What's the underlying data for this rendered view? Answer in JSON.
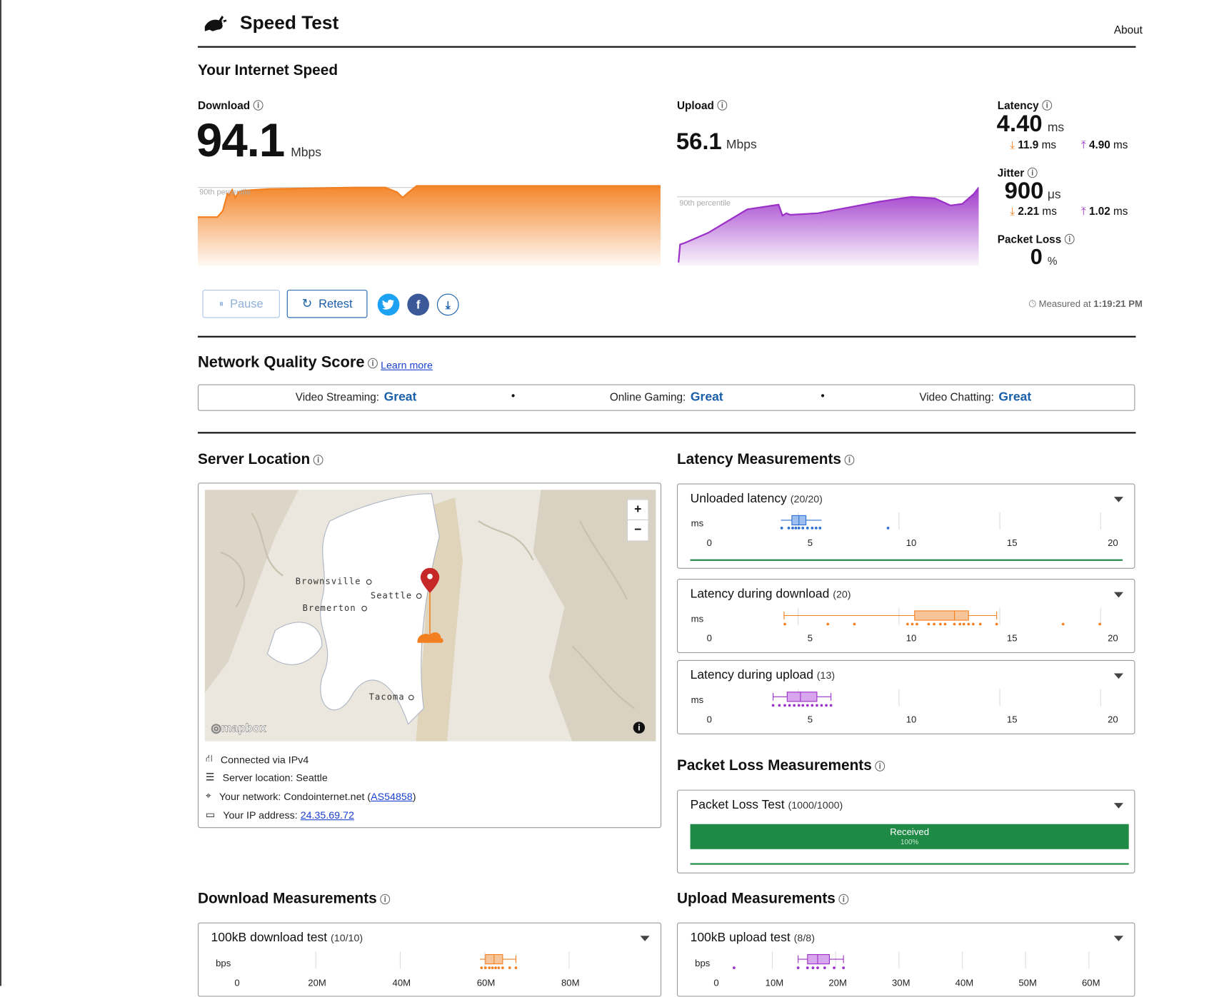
{
  "header": {
    "app_title": "Speed Test",
    "about_link": "About"
  },
  "speed": {
    "section_title": "Your Internet Speed",
    "download": {
      "label": "Download",
      "value": "94.1",
      "unit": "Mbps",
      "percentile_label": "90th percentile"
    },
    "upload": {
      "label": "Upload",
      "value": "56.1",
      "unit": "Mbps",
      "percentile_label": "90th percentile"
    },
    "latency": {
      "label": "Latency",
      "value": "4.40",
      "unit": "ms",
      "down_value": "11.9",
      "down_unit": "ms",
      "up_value": "4.90",
      "up_unit": "ms"
    },
    "jitter": {
      "label": "Jitter",
      "value": "900",
      "unit": "μs",
      "down_value": "2.21",
      "down_unit": "ms",
      "up_value": "1.02",
      "up_unit": "ms"
    },
    "packet_loss": {
      "label": "Packet Loss",
      "value": "0",
      "unit": "%"
    },
    "measured_prefix": "Measured at",
    "measured_time": "1:19:21 PM"
  },
  "actions": {
    "pause_label": "Pause",
    "retest_label": "Retest"
  },
  "nqs": {
    "title": "Network Quality Score",
    "learn_more": "Learn more",
    "items": [
      {
        "label": "Video Streaming:",
        "value": "Great"
      },
      {
        "label": "Online Gaming:",
        "value": "Great"
      },
      {
        "label": "Video Chatting:",
        "value": "Great"
      }
    ],
    "separator": "•"
  },
  "server": {
    "title": "Server Location",
    "map_labels": {
      "brownsville": "Brownsville",
      "seattle": "Seattle",
      "bremerton": "Bremerton",
      "tacoma": "Tacoma"
    },
    "map_brand": "mapbox",
    "zoom_in": "+",
    "zoom_out": "−",
    "connected": "Connected via IPv4",
    "server_location": "Server location: Seattle",
    "network_prefix": "Your network: Condointernet.net (",
    "network_as": "AS54858",
    "network_suffix": ")",
    "ip_prefix": "Your IP address:",
    "ip": "24.35.69.72"
  },
  "latency_measurements": {
    "title": "Latency Measurements",
    "unit": "ms",
    "ticks": [
      "0",
      "5",
      "10",
      "15",
      "20"
    ],
    "cards": [
      {
        "title": "Unloaded latency",
        "count": "(20/20)"
      },
      {
        "title": "Latency during download",
        "count": "(20)"
      },
      {
        "title": "Latency during upload",
        "count": "(13)"
      }
    ]
  },
  "packet_loss_measurements": {
    "title": "Packet Loss Measurements",
    "card_title": "Packet Loss Test",
    "count": "(1000/1000)",
    "bar_label": "Received",
    "bar_percent": "100%",
    "received_fraction": 1.0
  },
  "download_measurements": {
    "title": "Download Measurements",
    "card_title": "100kB download test",
    "count": "(10/10)",
    "unit": "bps",
    "ticks": [
      "0",
      "20M",
      "40M",
      "60M",
      "80M"
    ]
  },
  "upload_measurements": {
    "title": "Upload Measurements",
    "card_title": "100kB upload test",
    "count": "(8/8)",
    "unit": "bps",
    "ticks": [
      "0",
      "10M",
      "20M",
      "30M",
      "40M",
      "50M",
      "60M"
    ]
  },
  "colors": {
    "download": "#f38020",
    "upload": "#9b30c8",
    "unloaded": "#2c6fd1",
    "good": "#1e8a45",
    "link": "#1a3fcf",
    "accent": "#1a5fa8"
  }
}
